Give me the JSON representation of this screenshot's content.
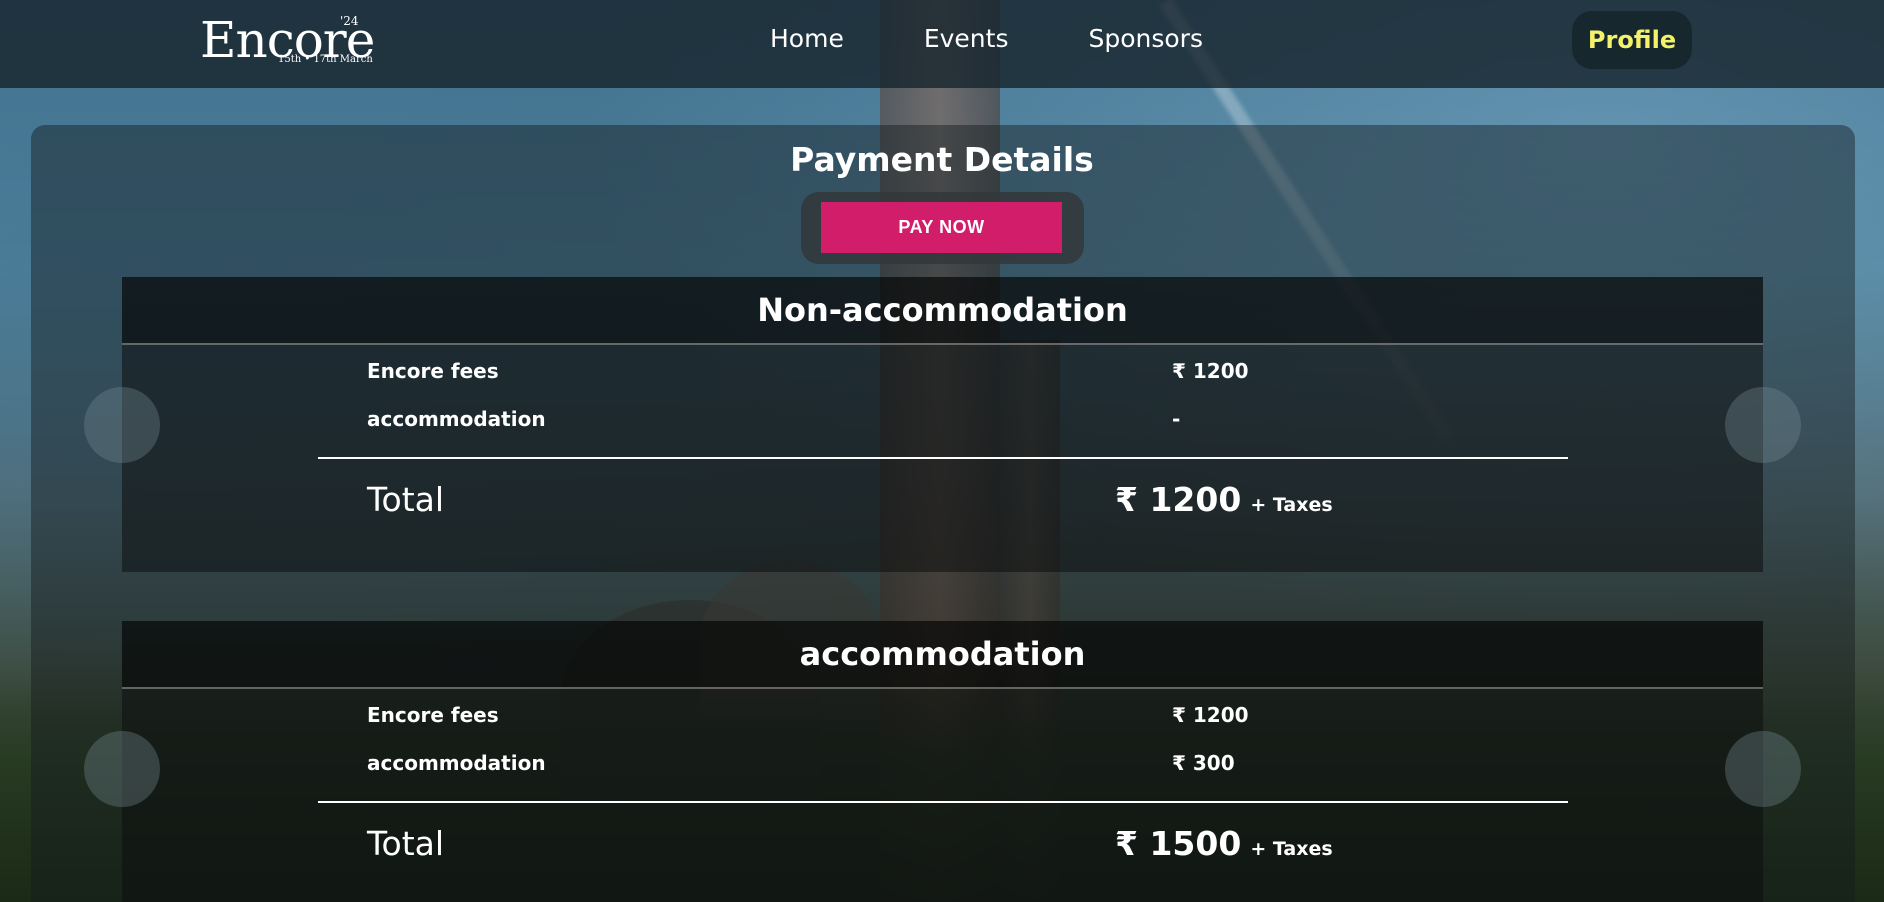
{
  "nav": {
    "logo_text": "Encore",
    "logo_year": "'24",
    "logo_dates": "15th • 17th March",
    "links": [
      "Home",
      "Events",
      "Sponsors"
    ],
    "profile_label": "Profile"
  },
  "page": {
    "title": "Payment Details",
    "pay_button": "PAY NOW"
  },
  "cards": [
    {
      "title": "Non-accommodation",
      "rows": [
        {
          "label": "Encore fees",
          "value": "₹ 1200"
        },
        {
          "label": "accommodation",
          "value": "-"
        }
      ],
      "total_label": "Total",
      "total_value": "₹ 1200",
      "total_suffix": "+ Taxes"
    },
    {
      "title": "accommodation",
      "rows": [
        {
          "label": "Encore fees",
          "value": "₹ 1200"
        },
        {
          "label": "accommodation",
          "value": "₹ 300"
        }
      ],
      "total_label": "Total",
      "total_value": "₹ 1500",
      "total_suffix": "+ Taxes"
    }
  ],
  "colors": {
    "accent": "#d11d6a",
    "profile_text": "#f4f16a"
  }
}
